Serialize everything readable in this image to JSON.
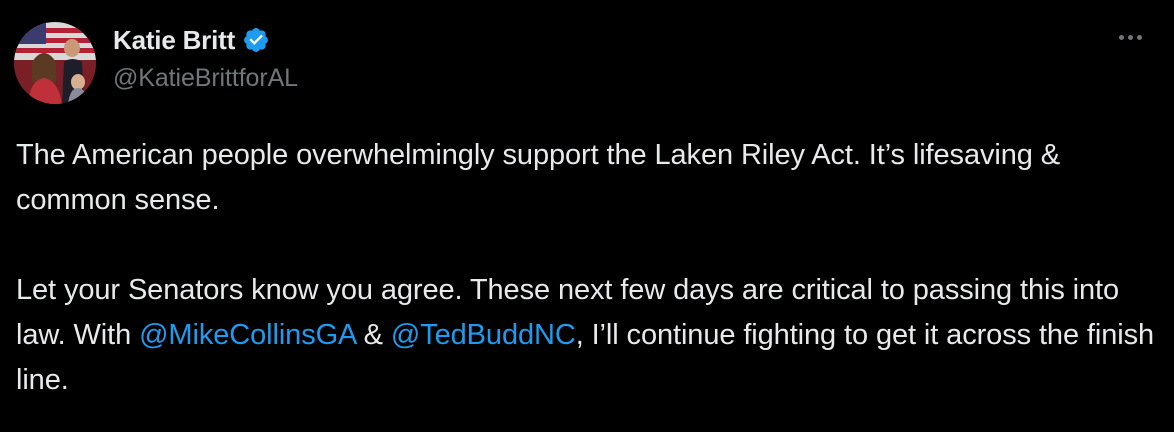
{
  "author": {
    "display_name": "Katie Britt",
    "handle": "@KatieBrittforAL",
    "verified": true
  },
  "icons": {
    "verified": "verified-badge-icon",
    "more": "more-horizontal-icon",
    "avatar": "profile-photo"
  },
  "colors": {
    "background": "#000000",
    "text": "#e7e9ea",
    "secondary": "#71767b",
    "link": "#1d9bf0",
    "badge": "#1d9bf0"
  },
  "tweet": {
    "paragraph1": "The American people overwhelmingly support the Laken Riley Act. It’s lifesaving & common sense.",
    "paragraph2_part1": "Let your Senators know you agree. These next few days are critical to passing this into law. With ",
    "mention1": "@MikeCollinsGA",
    "paragraph2_part2": " & ",
    "mention2": "@TedBuddNC",
    "paragraph2_part3": ", I’ll continue fighting to get it across the finish line."
  }
}
